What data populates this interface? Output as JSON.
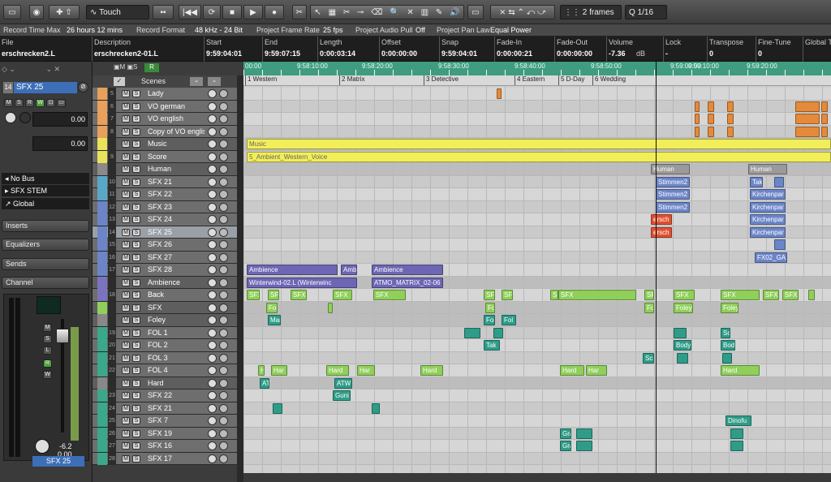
{
  "toolbar": {
    "automation_mode": "Touch",
    "grid": "2 frames",
    "quantize": "1/16"
  },
  "status": {
    "record_time_max_label": "Record Time Max",
    "record_time_max": "26 hours 12 mins",
    "record_format_label": "Record Format",
    "record_format": "48 kHz - 24 Bit",
    "frame_rate_label": "Project Frame Rate",
    "frame_rate": "25 fps",
    "pull_label": "Project Audio Pull",
    "pull": "Off",
    "pan_law_label": "Project Pan Law",
    "pan_law": "Equal Power"
  },
  "infoline": {
    "columns": [
      {
        "label": "File",
        "value": "erschrecken2.L"
      },
      {
        "label": "Description",
        "value": "erschrecken2-01.L"
      },
      {
        "label": "Start",
        "value": "9:59:04:01"
      },
      {
        "label": "End",
        "value": "9:59:07:15"
      },
      {
        "label": "Length",
        "value": "0:00:03:14"
      },
      {
        "label": "Offset",
        "value": "0:00:00:00"
      },
      {
        "label": "Snap",
        "value": "9:59:04:01"
      },
      {
        "label": "Fade-In",
        "value": "0:00:00:21"
      },
      {
        "label": "Fade-Out",
        "value": "0:00:00:00"
      },
      {
        "label": "Volume",
        "value": "-7.36"
      },
      {
        "label": "Lock",
        "value": "-"
      },
      {
        "label": "Transpose",
        "value": "0"
      },
      {
        "label": "Fine-Tune",
        "value": "0"
      },
      {
        "label": "Global T",
        "value": ""
      }
    ],
    "volume_unit": "dB"
  },
  "inspector": {
    "track_name": "SFX 25",
    "track_num": "14",
    "vol1": "0.00",
    "vol2": "0.00",
    "routing": [
      "No Bus",
      "SFX STEM",
      "Global"
    ],
    "sections": [
      "Inserts",
      "Equalizers",
      "Sends",
      "Channel"
    ],
    "fader_val": "-6.2",
    "fader_val2": "0.00",
    "footer_name": "SFX 25"
  },
  "scenes_label": "Scenes",
  "tracks": [
    {
      "num": "5",
      "name": "Lady",
      "color": "#e8a05a"
    },
    {
      "num": "6",
      "name": "VO german",
      "color": "#e8a05a"
    },
    {
      "num": "7",
      "name": "VO english",
      "color": "#e8a05a"
    },
    {
      "num": "8",
      "name": "Copy of VO englis",
      "color": "#e8a05a"
    },
    {
      "num": "",
      "name": "Music",
      "color": "#e9e25a",
      "folder": true
    },
    {
      "num": "9",
      "name": "Score",
      "color": "#e9e25a"
    },
    {
      "num": "",
      "name": "Human",
      "color": "#8a8a8a",
      "folder": true
    },
    {
      "num": "10",
      "name": "SFX 21",
      "color": "#5aa8c8"
    },
    {
      "num": "11",
      "name": "SFX 22",
      "color": "#5aa8c8"
    },
    {
      "num": "12",
      "name": "SFX 23",
      "color": "#6b85c8"
    },
    {
      "num": "13",
      "name": "SFX 24",
      "color": "#6b85c8"
    },
    {
      "num": "14",
      "name": "SFX 25",
      "color": "#6b85c8",
      "selected": true
    },
    {
      "num": "15",
      "name": "SFX 26",
      "color": "#6b85c8"
    },
    {
      "num": "16",
      "name": "SFX 27",
      "color": "#6b85c8"
    },
    {
      "num": "17",
      "name": "SFX 28",
      "color": "#6b85c8"
    },
    {
      "num": "",
      "name": "Ambience",
      "color": "#7a74c0",
      "folder": true
    },
    {
      "num": "18",
      "name": "Back",
      "color": "#7a74c0"
    },
    {
      "num": "",
      "name": "SFX",
      "color": "#8fcf5a",
      "folder": true
    },
    {
      "num": "",
      "name": "Foley",
      "color": "#888888",
      "folder": true
    },
    {
      "num": "19",
      "name": "FOL 1",
      "color": "#3aa88a"
    },
    {
      "num": "20",
      "name": "FOL 2",
      "color": "#3aa88a"
    },
    {
      "num": "21",
      "name": "FOL 3",
      "color": "#3aa88a"
    },
    {
      "num": "22",
      "name": "FOL 4",
      "color": "#3aa88a"
    },
    {
      "num": "",
      "name": "Hard",
      "color": "#888888",
      "folder": true
    },
    {
      "num": "23",
      "name": "SFX 22",
      "color": "#3aa88a"
    },
    {
      "num": "24",
      "name": "SFX 21",
      "color": "#3aa88a"
    },
    {
      "num": "25",
      "name": "SFX 7",
      "color": "#3aa88a"
    },
    {
      "num": "26",
      "name": "SFX 19",
      "color": "#3aa88a"
    },
    {
      "num": "27",
      "name": "SFX 16",
      "color": "#3aa88a"
    },
    {
      "num": "28",
      "name": "SFX 17",
      "color": "#3aa88a"
    }
  ],
  "ruler": {
    "ticks": [
      "00:00",
      "9:58:10:00",
      "9:58:20:00",
      "9:58:30:00",
      "9:58:40:00",
      "9:58:50:00",
      "9:59:00:00",
      "9:59:10:00",
      "9:59:20:00"
    ]
  },
  "markers": [
    {
      "label": "1 Western"
    },
    {
      "label": "2 Matrix"
    },
    {
      "label": "3 Detective"
    },
    {
      "label": "4 Eastern"
    },
    {
      "label": "5 D-Day"
    },
    {
      "label": "6 Wedding"
    }
  ],
  "events": {
    "music": "Music",
    "score": "5_Ambient_Western_Voice",
    "human": "Human",
    "stimmen": "Stimmen2",
    "kirchen": "Kirchenpar",
    "ersch": "ersch",
    "fx02": "FX02_GA",
    "tak": "Tak",
    "ambience": "Ambience",
    "amb": "Amb",
    "wind": "Winterwind-02.L (Winterwinc",
    "atmo": "ATMO_MATRIX_02-06",
    "sfx": "SFX",
    "foley": "Foley",
    "fol": "Fol",
    "mar": "Mar",
    "body": "Body",
    "bod": "Bod",
    "hard": "Hard",
    "har": "Har",
    "atw": "ATW",
    "guni": "Guni",
    "dinofu": "Dinofu",
    "gra": "Gra",
    "scr": "Scr",
    "sci": "Sci",
    "fo": "Fo"
  }
}
